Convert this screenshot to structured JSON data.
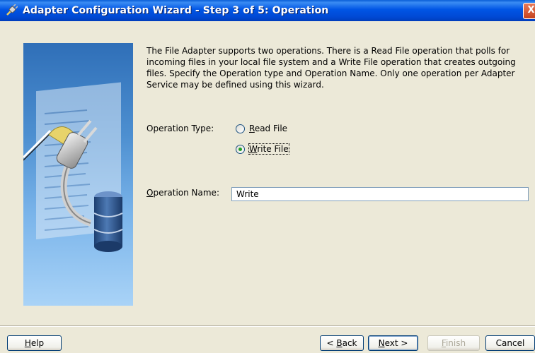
{
  "window": {
    "title": "Adapter Configuration Wizard - Step 3 of 5: Operation",
    "close_glyph": "X",
    "colors": {
      "title_bar": "#0055e5",
      "face": "#ece9d8",
      "accent_radio": "#21a121"
    }
  },
  "content": {
    "description": "The File Adapter supports two operations.  There is a Read File operation that polls for incoming files in your local file system and a Write File operation that creates outgoing files.  Specify the Operation type and Operation Name.  Only one operation per Adapter Service may be defined using this wizard.",
    "operation_type": {
      "label": "Operation Type:",
      "options": [
        {
          "key": "R",
          "rest": "ead File",
          "checked": false
        },
        {
          "key": "W",
          "rest": "rite File",
          "checked": true
        }
      ]
    },
    "operation_name": {
      "label_key": "O",
      "label_rest": "peration Name:",
      "value": "Write"
    }
  },
  "footer": {
    "help": {
      "key": "H",
      "rest": "elp"
    },
    "back": {
      "pre": "< ",
      "key": "B",
      "rest": "ack"
    },
    "next": {
      "key": "N",
      "rest": "ext >"
    },
    "finish": {
      "key": "F",
      "rest": "inish"
    },
    "cancel": "Cancel"
  },
  "icons": {
    "title": "plug-icon",
    "side_image": "adapter-plug-database-illustration"
  }
}
